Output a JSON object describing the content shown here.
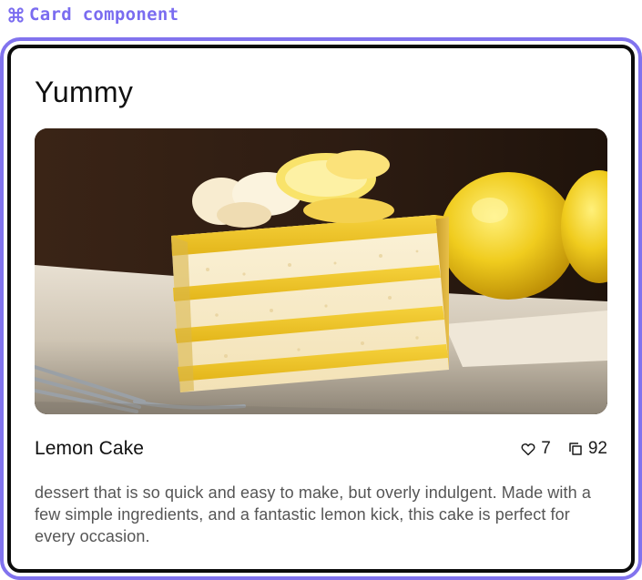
{
  "component_label": {
    "icon": "command-icon",
    "text": "Card component",
    "color": "#7a6cf0"
  },
  "frame": {
    "selection_color": "#8173ee",
    "card_border_color": "#0b0b0b"
  },
  "card": {
    "title": "Yummy",
    "image_subject": "lemon-cake-photo",
    "product_name": "Lemon Cake",
    "likes": {
      "icon": "heart-icon",
      "count": "7"
    },
    "copies": {
      "icon": "copy-icon",
      "count": "92"
    },
    "description": "dessert that is so quick and easy to make, but overly indulgent. Made with a few simple ingredients, and a fantastic lemon kick, this cake is perfect for every occasion."
  }
}
